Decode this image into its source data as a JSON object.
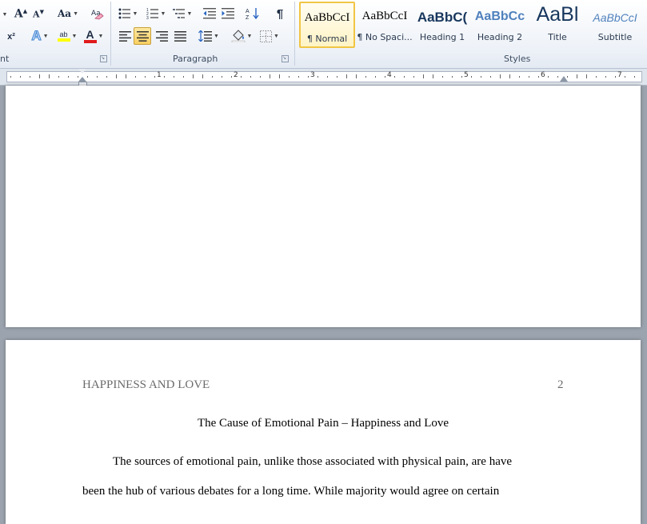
{
  "ribbon": {
    "font_group_label": "nt",
    "paragraph_group_label": "Paragraph",
    "styles_group_label": "Styles",
    "change_case_label": "Aa",
    "font_color_glyph": "A",
    "text_effects_glyph": "A",
    "highlight_glyph": "ab",
    "superscript_glyph": "x²",
    "pilcrow_glyph": "¶",
    "accent_color": "#f9cf62"
  },
  "styles": [
    {
      "preview": "AaBbCcI",
      "name": "¶ Normal",
      "active": true
    },
    {
      "preview": "AaBbCcI",
      "name": "¶ No Spaci...",
      "active": false
    },
    {
      "preview": "AaBbC(",
      "name": "Heading 1",
      "active": false
    },
    {
      "preview": "AaBbCc",
      "name": "Heading 2",
      "active": false
    },
    {
      "preview": "AaBl",
      "name": "Title",
      "active": false
    },
    {
      "preview": "AaBbCcI",
      "name": "Subtitle",
      "active": false
    }
  ],
  "ruler": {
    "numbers": [
      "1",
      "2",
      "3",
      "4",
      "5",
      "6",
      "7"
    ]
  },
  "document": {
    "header_left": "HAPPINESS AND LOVE",
    "page_number": "2",
    "title": "The Cause of Emotional Pain – Happiness and Love",
    "line1": "The sources of emotional pain, unlike those associated with physical pain, are have",
    "line2": "been the hub of various debates for a long time. While majority would agree on certain"
  }
}
